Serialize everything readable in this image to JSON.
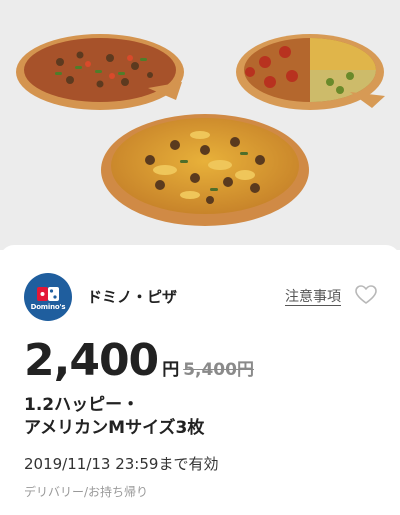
{
  "hero": {
    "image_description_icon": "pizza-photo"
  },
  "coupon": {
    "brand_name": "ドミノ・ピザ",
    "logo_text": "Domino's",
    "notes_link": "注意事項",
    "favorite_icon": "heart-outline-icon",
    "price": "2,400",
    "currency": "円",
    "original_price": "5,400円",
    "title_line1": "1.2ハッピー・",
    "title_line2": "アメリカンMサイズ3枚",
    "validity": "2019/11/13 23:59まで有効",
    "delivery_method": "デリバリー/お持ち帰り"
  },
  "colors": {
    "logo_blue": "#1f5e9e",
    "logo_red": "#e31837",
    "hero_bg": "#ececec"
  }
}
